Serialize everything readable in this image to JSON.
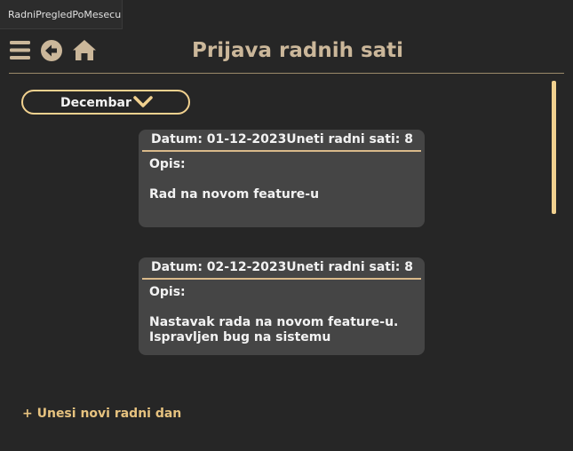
{
  "window": {
    "tab_title": "RadniPregledPoMesecu"
  },
  "header": {
    "title": "Prijava radnih sati",
    "icons": [
      "menu-icon",
      "back-icon",
      "home-icon"
    ]
  },
  "month_select": {
    "value": "Decembar"
  },
  "entries": [
    {
      "date": "Datum: 01-12-2023",
      "hours": "Uneti radni sati: 8",
      "opis_label": "Opis:",
      "description": "Rad na novom feature-u"
    },
    {
      "date": "Datum: 02-12-2023",
      "hours": "Uneti radni sati: 8",
      "opis_label": "Opis:",
      "description": "Nastavak rada na novom feature-u.\nIspravljen bug na sistemu"
    }
  ],
  "add_entry_label": "+ Unesi novi radni dan",
  "colors": {
    "background": "#262626",
    "accent": "#f1d18f",
    "card": "#454545",
    "title": "#cbb79a",
    "link": "#e6c27f"
  }
}
